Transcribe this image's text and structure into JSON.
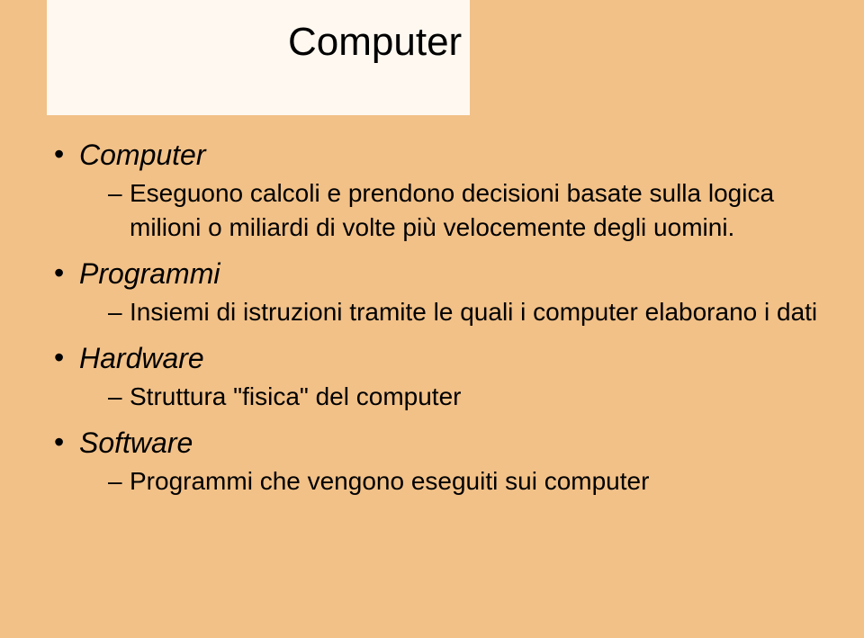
{
  "title": "Computer",
  "items": [
    {
      "label": "Computer",
      "sub": [
        "Eseguono calcoli e prendono decisioni basate sulla logica milioni o miliardi di volte più velocemente degli uomini."
      ]
    },
    {
      "label": "Programmi",
      "sub": [
        "Insiemi di istruzioni tramite le quali i computer elaborano i dati"
      ]
    },
    {
      "label": "Hardware",
      "sub": [
        "Struttura \"fisica\" del computer"
      ]
    },
    {
      "label": "Software",
      "sub": [
        "Programmi che vengono eseguiti sui computer"
      ]
    }
  ]
}
